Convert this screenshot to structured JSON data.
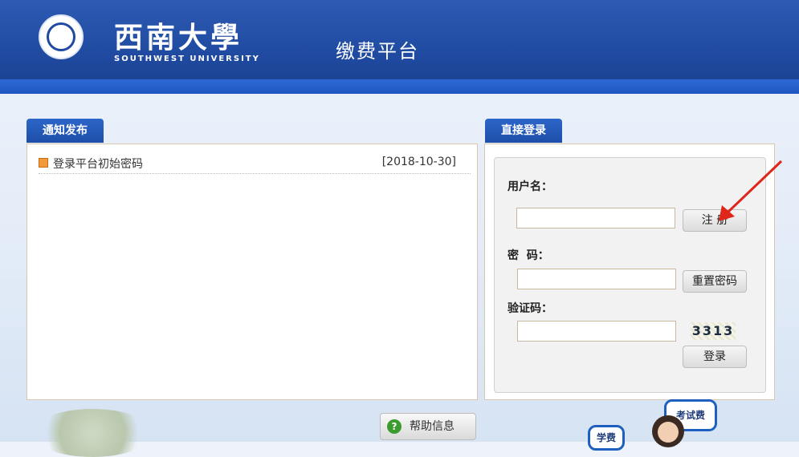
{
  "header": {
    "university_cn": "西南大學",
    "university_en": "SOUTHWEST UNIVERSITY",
    "platform_title": "缴费平台"
  },
  "notice": {
    "tab_label": "通知发布",
    "items": [
      {
        "title": "登录平台初始密码",
        "date": "[2018-10-30]"
      }
    ]
  },
  "login": {
    "tab_label": "直接登录",
    "username_label": "用户名：",
    "password_label": "密  码：",
    "captcha_label": "验证码：",
    "register_button": "注 册",
    "reset_password_button": "重置密码",
    "login_button": "登录",
    "captcha_value": "3313",
    "username_value": "",
    "password_value": "",
    "captcha_input_value": ""
  },
  "help": {
    "label": "帮助信息"
  },
  "decor": {
    "bubble_exam": "考试费",
    "bubble_tuition": "学费"
  },
  "colors": {
    "brand_blue": "#1f4aa0",
    "accent_orange": "#f29a3b"
  },
  "icons": {
    "logo": "university-seal-icon",
    "notice_bullet": "arrow-bullet-icon",
    "help": "question-circle-icon"
  }
}
